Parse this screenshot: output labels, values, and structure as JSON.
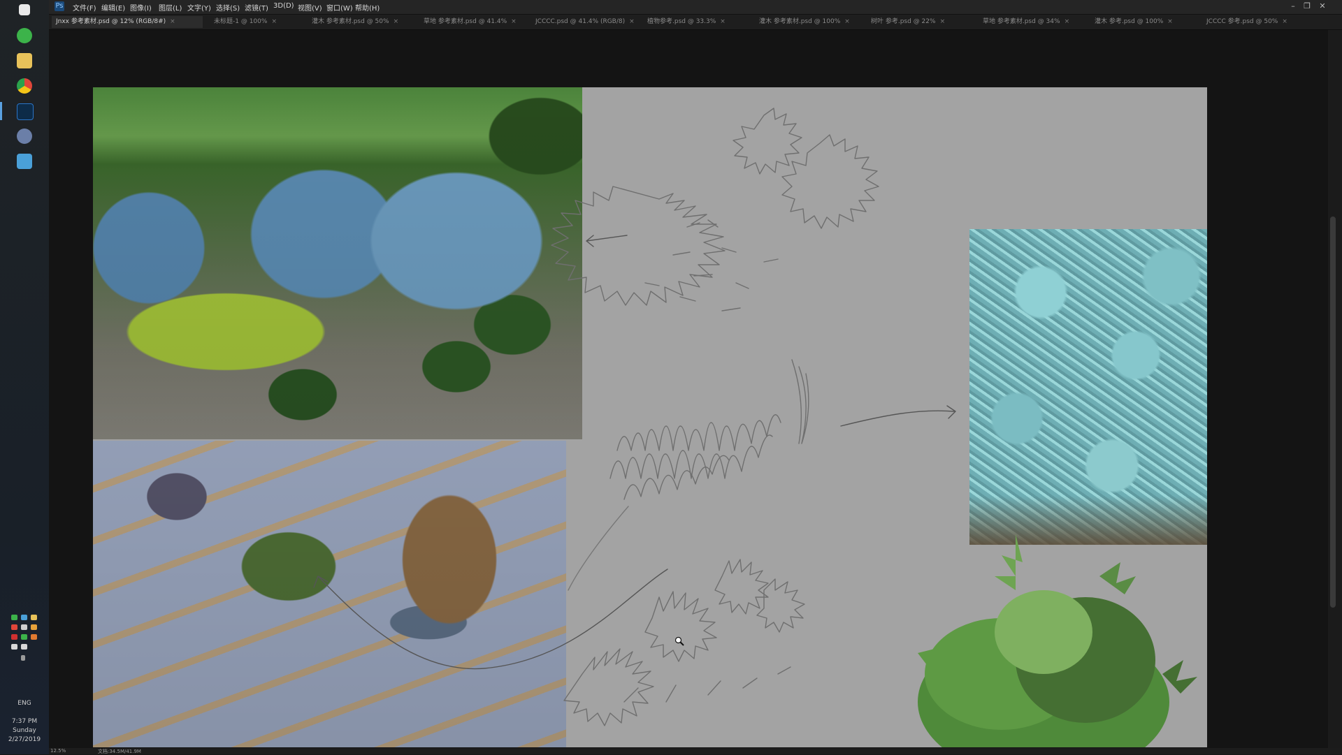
{
  "app": {
    "logo_label": "Ps"
  },
  "menu": {
    "items": [
      "文件(F)",
      "编辑(E)",
      "图像(I)",
      "图层(L)",
      "文字(Y)",
      "选择(S)",
      "滤镜(T)",
      "3D(D)",
      "视图(V)",
      "窗口(W)",
      "帮助(H)"
    ]
  },
  "window_controls": {
    "minimize": "–",
    "restore": "❐",
    "close": "✕"
  },
  "tabs": [
    {
      "label": "Jnxx 参考素材.psd @ 12% (RGB/8#)",
      "active": true
    },
    {
      "label": "未标题-1 @ 100%",
      "active": false
    },
    {
      "label": "灌木 参考素材.psd @ 50%",
      "active": false
    },
    {
      "label": "草地 参考素材.psd @ 41.4%",
      "active": false
    },
    {
      "label": "JCCCC.psd @ 41.4% (RGB/8)",
      "active": false
    },
    {
      "label": "植物参考.psd @ 33.3%",
      "active": false
    },
    {
      "label": "灌木 参考素材.psd @ 100%",
      "active": false
    },
    {
      "label": "树叶 参考.psd @ 22%",
      "active": false
    },
    {
      "label": "草地 参考素材.psd @ 34%",
      "active": false
    },
    {
      "label": "灌木 参考.psd @ 100%",
      "active": false
    },
    {
      "label": "JCCCC 参考.psd @ 50%",
      "active": false
    }
  ],
  "taskbar": {
    "pinned": [
      {
        "name": "windows-icon",
        "color": "#e9e9e9"
      },
      {
        "name": "wechat-icon",
        "color": "#3cb34a"
      },
      {
        "name": "folder-icon",
        "color": "#e8c25a"
      },
      {
        "name": "chrome-icon",
        "color": "#e0463a"
      },
      {
        "name": "photoshop-icon",
        "color": "#2b74c7"
      },
      {
        "name": "browser-icon",
        "color": "#6b7fa8"
      },
      {
        "name": "media-icon",
        "color": "#4aa0d8"
      }
    ],
    "clock_time": "7:37 PM",
    "clock_day": "Sunday",
    "clock_date": "2/27/2019",
    "input_method": "ENG"
  },
  "status": {
    "zoom": "12.5%",
    "doc_info": "文档:34.5M/41.9M"
  },
  "colors": {
    "artboard": "#a3a3a3",
    "sketch_stroke": "#6f6f6f",
    "arrow_stroke": "#555555",
    "painted_shrub": "#4f8a3a"
  }
}
